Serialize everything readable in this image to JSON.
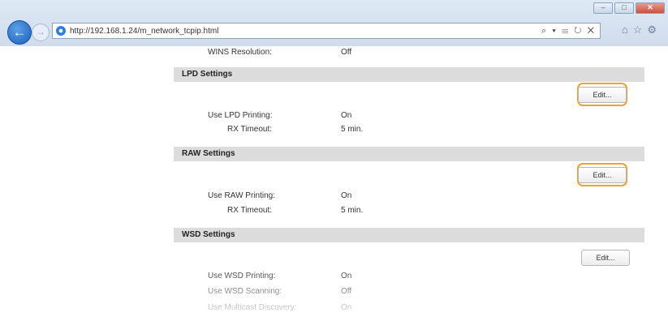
{
  "browser": {
    "url": "http://192.168.1.24/m_network_tcpip.html",
    "address_tools": "⌕ ▾ ☰ ↻ ✕",
    "win_buttons": [
      "–",
      "□",
      "✕"
    ]
  },
  "page": {
    "wins_resolution": {
      "label": "WINS Resolution:",
      "value": "Off"
    },
    "lpd": {
      "title": "LPD Settings",
      "edit_label": "Edit...",
      "use_printing": {
        "label": "Use LPD Printing:",
        "value": "On"
      },
      "rx_timeout": {
        "label": "RX Timeout:",
        "value": "5 min."
      }
    },
    "raw": {
      "title": "RAW Settings",
      "edit_label": "Edit...",
      "use_printing": {
        "label": "Use RAW Printing:",
        "value": "On"
      },
      "rx_timeout": {
        "label": "RX Timeout:",
        "value": "5 min."
      }
    },
    "wsd": {
      "title": "WSD Settings",
      "edit_label": "Edit...",
      "use_printing": {
        "label": "Use WSD Printing:",
        "value": "On"
      },
      "use_scanning": {
        "label": "Use WSD Scanning:",
        "value": "Off"
      },
      "multicast": {
        "label": "Use Multicast Discovery:",
        "value": "On"
      }
    }
  },
  "colors": {
    "highlight": "#f2a12a",
    "section_bg": "#dcdcdc"
  }
}
